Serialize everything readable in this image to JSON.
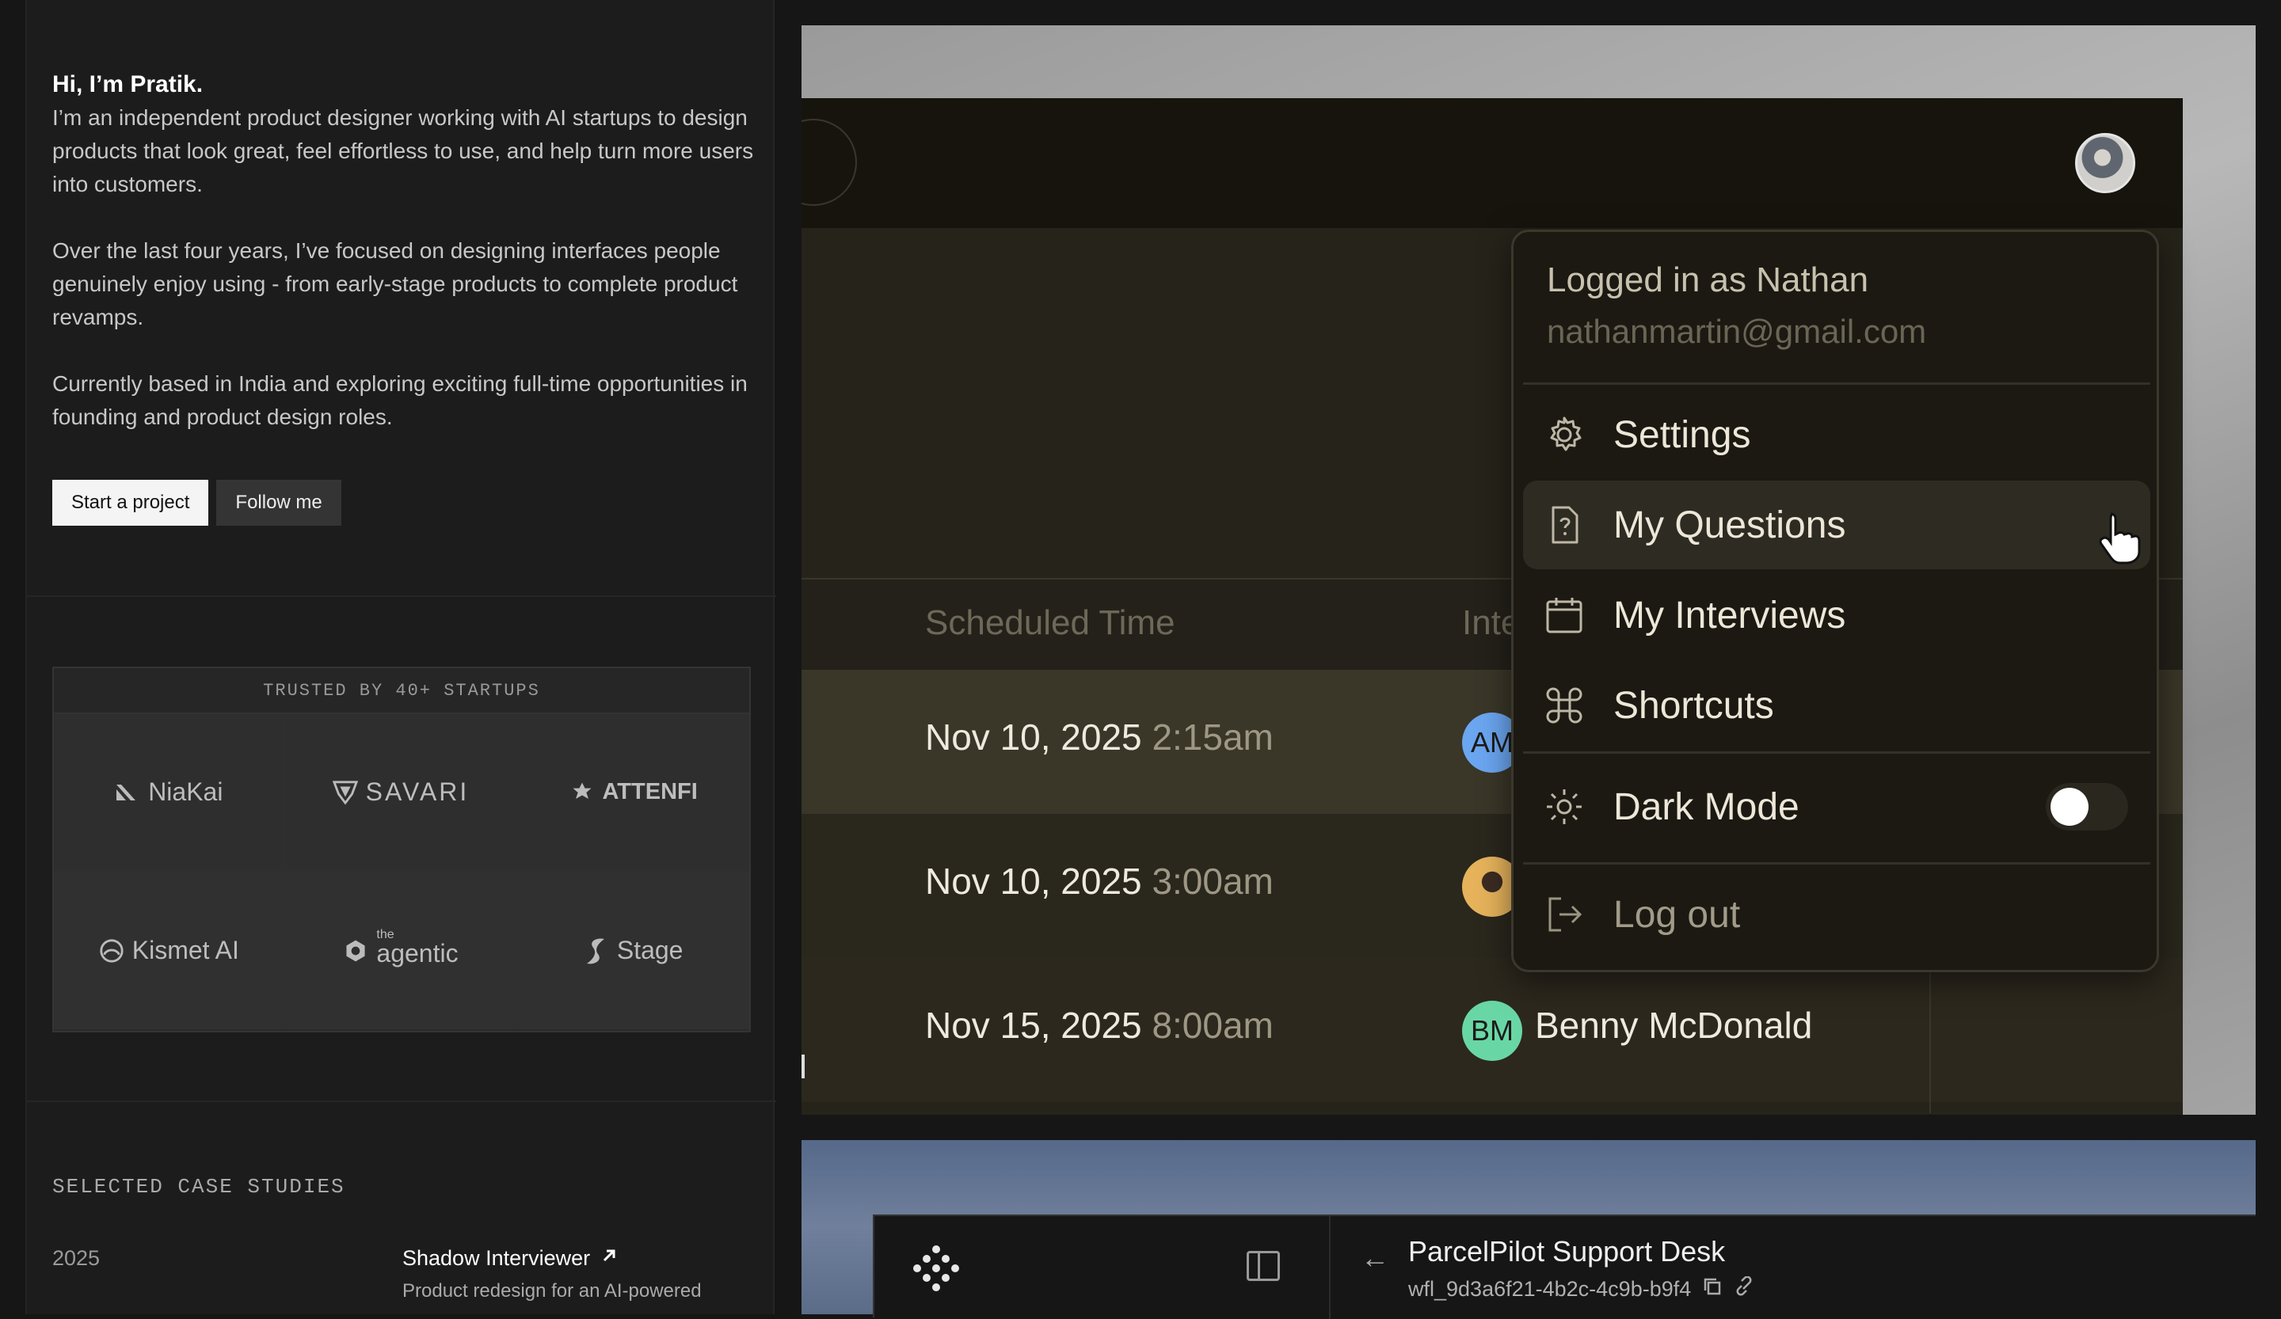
{
  "profile": {
    "greeting": "Hi, I’m Pratik.",
    "intro_1": "I’m an independent product designer working with AI startups to design products that look great, feel effortless to use, and help turn more users into customers.",
    "intro_2": "Over the last four years, I’ve focused on designing interfaces people genuinely enjoy using - from early-stage products to complete product revamps.",
    "intro_3": "Currently based in India and exploring exciting full-time opportunities in founding and product design roles.",
    "start_label": "Start a project",
    "follow_label": "Follow me"
  },
  "trusted": {
    "heading": "TRUSTED BY 40+ STARTUPS",
    "logos": [
      "NiaKai",
      "SAVARI",
      "ATTENFI",
      "Kismet AI",
      "agentic",
      "Stage"
    ],
    "agentic_prefix": "the"
  },
  "cases": {
    "heading": "SELECTED CASE STUDIES",
    "year": "2025",
    "title": "Shadow Interviewer",
    "desc": "Product redesign for an AI-powered"
  },
  "shot1": {
    "table_headers": [
      "Scheduled Time",
      "Inte"
    ],
    "rows": [
      {
        "date": "Nov 10, 2025",
        "time": "2:15am",
        "initials": "AM",
        "name": ""
      },
      {
        "date": "Nov 10, 2025",
        "time": "3:00am",
        "initials": "",
        "name": ""
      },
      {
        "date": "Nov 15, 2025",
        "time": "8:00am",
        "initials": "BM",
        "name": "Benny McDonald"
      }
    ],
    "menu": {
      "logged_in": "Logged in as Nathan",
      "email": "nathanmartin@gmail.com",
      "settings": "Settings",
      "questions": "My Questions",
      "interviews": "My Interviews",
      "shortcuts": "Shortcuts",
      "dark_mode": "Dark Mode",
      "dark_mode_on": false,
      "logout": "Log out"
    }
  },
  "shot2": {
    "title": "ParcelPilot Support Desk",
    "workflow_id": "wfl_9d3a6f21-4b2c-4c9b-b9f4"
  }
}
